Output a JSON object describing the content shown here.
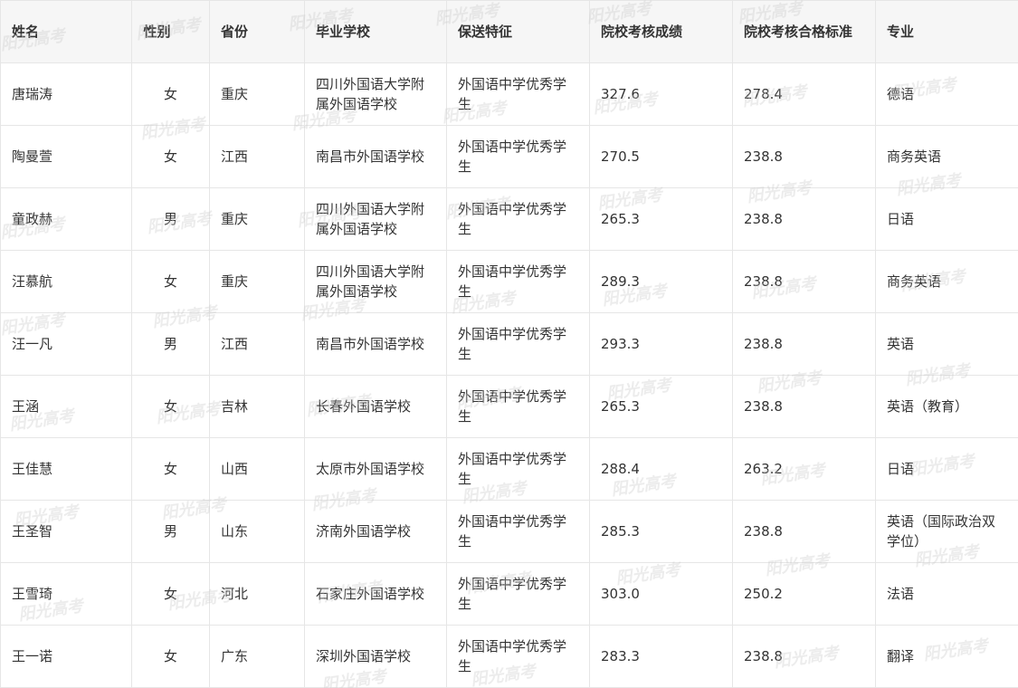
{
  "table": {
    "headers": [
      "姓名",
      "性别",
      "省份",
      "毕业学校",
      "保送特征",
      "院校考核成绩",
      "院校考核合格标准",
      "专业"
    ],
    "rows": [
      {
        "name": "唐瑞涛",
        "gender": "女",
        "province": "重庆",
        "school": "四川外国语大学附属外国语学校",
        "feature": "外国语中学优秀学生",
        "score": "327.6",
        "standard": "278.4",
        "major": "德语"
      },
      {
        "name": "陶曼萱",
        "gender": "女",
        "province": "江西",
        "school": "南昌市外国语学校",
        "feature": "外国语中学优秀学生",
        "score": "270.5",
        "standard": "238.8",
        "major": "商务英语"
      },
      {
        "name": "童政赫",
        "gender": "男",
        "province": "重庆",
        "school": "四川外国语大学附属外国语学校",
        "feature": "外国语中学优秀学生",
        "score": "265.3",
        "standard": "238.8",
        "major": "日语"
      },
      {
        "name": "汪慕航",
        "gender": "女",
        "province": "重庆",
        "school": "四川外国语大学附属外国语学校",
        "feature": "外国语中学优秀学生",
        "score": "289.3",
        "standard": "238.8",
        "major": "商务英语"
      },
      {
        "name": "汪一凡",
        "gender": "男",
        "province": "江西",
        "school": "南昌市外国语学校",
        "feature": "外国语中学优秀学生",
        "score": "293.3",
        "standard": "238.8",
        "major": "英语"
      },
      {
        "name": "王涵",
        "gender": "女",
        "province": "吉林",
        "school": "长春外国语学校",
        "feature": "外国语中学优秀学生",
        "score": "265.3",
        "standard": "238.8",
        "major": "英语（教育）"
      },
      {
        "name": "王佳慧",
        "gender": "女",
        "province": "山西",
        "school": "太原市外国语学校",
        "feature": "外国语中学优秀学生",
        "score": "288.4",
        "standard": "263.2",
        "major": "日语"
      },
      {
        "name": "王圣智",
        "gender": "男",
        "province": "山东",
        "school": "济南外国语学校",
        "feature": "外国语中学优秀学生",
        "score": "285.3",
        "standard": "238.8",
        "major": "英语（国际政治双学位）"
      },
      {
        "name": "王雪琦",
        "gender": "女",
        "province": "河北",
        "school": "石家庄外国语学校",
        "feature": "外国语中学优秀学生",
        "score": "303.0",
        "standard": "250.2",
        "major": "法语"
      },
      {
        "name": "王一诺",
        "gender": "女",
        "province": "广东",
        "school": "深圳外国语学校",
        "feature": "外国语中学优秀学生",
        "score": "283.3",
        "standard": "238.8",
        "major": "翻译"
      }
    ]
  },
  "watermark": {
    "text": "阳光高考"
  }
}
